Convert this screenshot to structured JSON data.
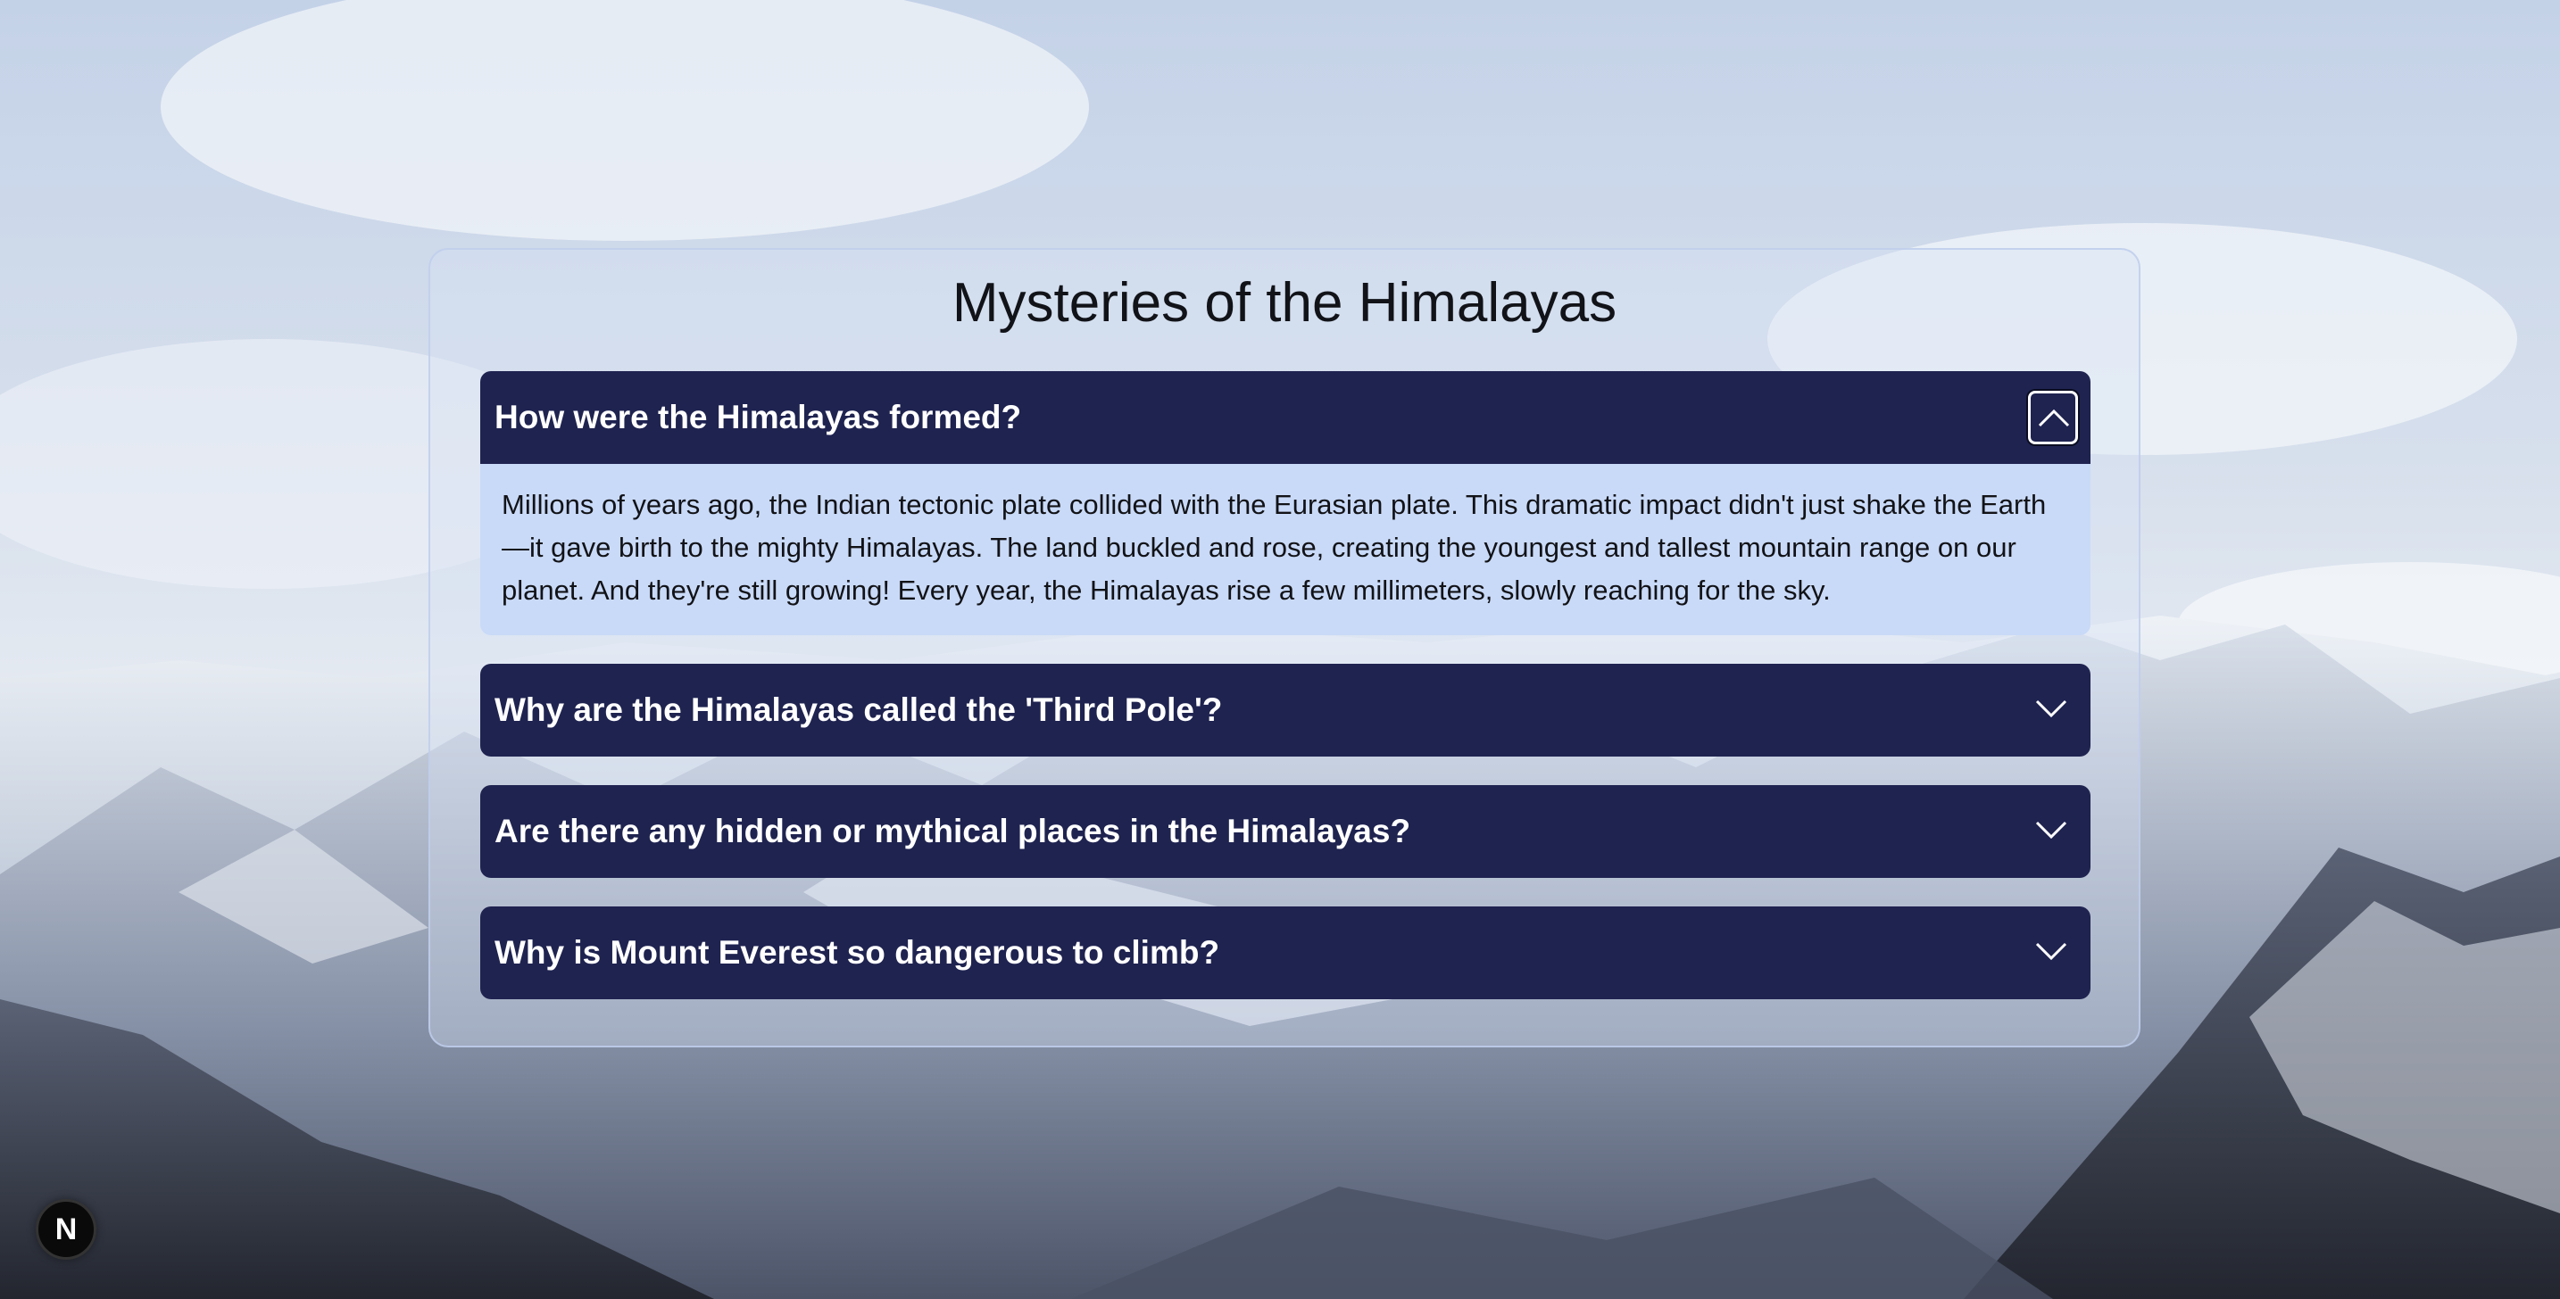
{
  "page": {
    "title": "Mysteries of the Himalayas"
  },
  "faqs": [
    {
      "question": "How were the Himalayas formed?",
      "answer": "Millions of years ago, the Indian tectonic plate collided with the Eurasian plate. This dramatic impact didn't just shake the Earth—it gave birth to the mighty Himalayas. The land buckled and rose, creating the youngest and tallest mountain range on our planet. And they're still growing! Every year, the Himalayas rise a few millimeters, slowly reaching for the sky.",
      "expanded": true,
      "icon": "chevron-up-icon"
    },
    {
      "question": "Why are the Himalayas called the 'Third Pole'?",
      "expanded": false,
      "icon": "chevron-down-icon"
    },
    {
      "question": "Are there any hidden or mythical places in the Himalayas?",
      "expanded": false,
      "icon": "chevron-down-icon"
    },
    {
      "question": "Why is Mount Everest so dangerous to climb?",
      "expanded": false,
      "icon": "chevron-down-icon"
    }
  ],
  "badge": {
    "label": "N",
    "icon": "nextjs-logo-icon"
  },
  "colors": {
    "header_bg": "#1f2350",
    "answer_bg": "#c9daf8",
    "header_text": "#ffffff"
  }
}
